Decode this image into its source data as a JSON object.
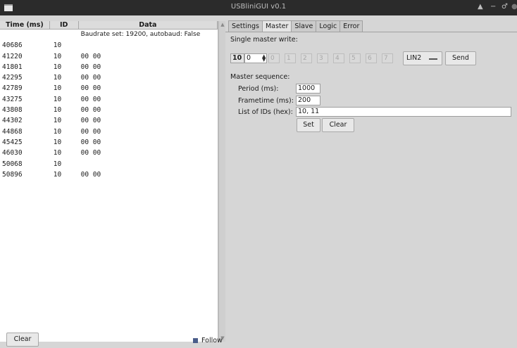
{
  "window": {
    "title": "USBliniGUI v0.1",
    "controls": [
      "▲",
      "−",
      "♂",
      "●"
    ]
  },
  "log": {
    "columns": [
      "Time (ms)",
      "ID",
      "Data"
    ],
    "rows": [
      {
        "time": "",
        "id": "",
        "data": "Baudrate set: 19200, autobaud: False"
      },
      {
        "time": "40686",
        "id": "10",
        "data": ""
      },
      {
        "time": "41220",
        "id": "10",
        "data": "00 00"
      },
      {
        "time": "41801",
        "id": "10",
        "data": "00 00"
      },
      {
        "time": "42295",
        "id": "10",
        "data": "00 00"
      },
      {
        "time": "42789",
        "id": "10",
        "data": "00 00"
      },
      {
        "time": "43275",
        "id": "10",
        "data": "00 00"
      },
      {
        "time": "43808",
        "id": "10",
        "data": "00 00"
      },
      {
        "time": "44302",
        "id": "10",
        "data": "00 00"
      },
      {
        "time": "44868",
        "id": "10",
        "data": "00 00"
      },
      {
        "time": "45425",
        "id": "10",
        "data": "00 00"
      },
      {
        "time": "46030",
        "id": "10",
        "data": "00 00"
      },
      {
        "time": "50068",
        "id": "10",
        "data": ""
      },
      {
        "time": "50896",
        "id": "10",
        "data": "00 00"
      }
    ],
    "clear_label": "Clear",
    "follow_label": "Follow"
  },
  "tabs": [
    {
      "label": "Settings",
      "active": false
    },
    {
      "label": "Master",
      "active": true
    },
    {
      "label": "Slave",
      "active": false
    },
    {
      "label": "Logic",
      "active": false
    },
    {
      "label": "Error",
      "active": false
    }
  ],
  "master": {
    "single_write_label": "Single master write:",
    "id_value": "10",
    "length_value": "0",
    "bytes": [
      "0",
      "1",
      "2",
      "3",
      "4",
      "5",
      "6",
      "7"
    ],
    "lin_version": "LIN2",
    "send_label": "Send",
    "sequence_label": "Master sequence:",
    "period_label": "Period (ms):",
    "period_value": "1000",
    "frametime_label": "Frametime (ms):",
    "frametime_value": "200",
    "ids_label": "List of IDs (hex):",
    "ids_value": "10, 11",
    "set_label": "Set",
    "clear_label": "Clear"
  }
}
